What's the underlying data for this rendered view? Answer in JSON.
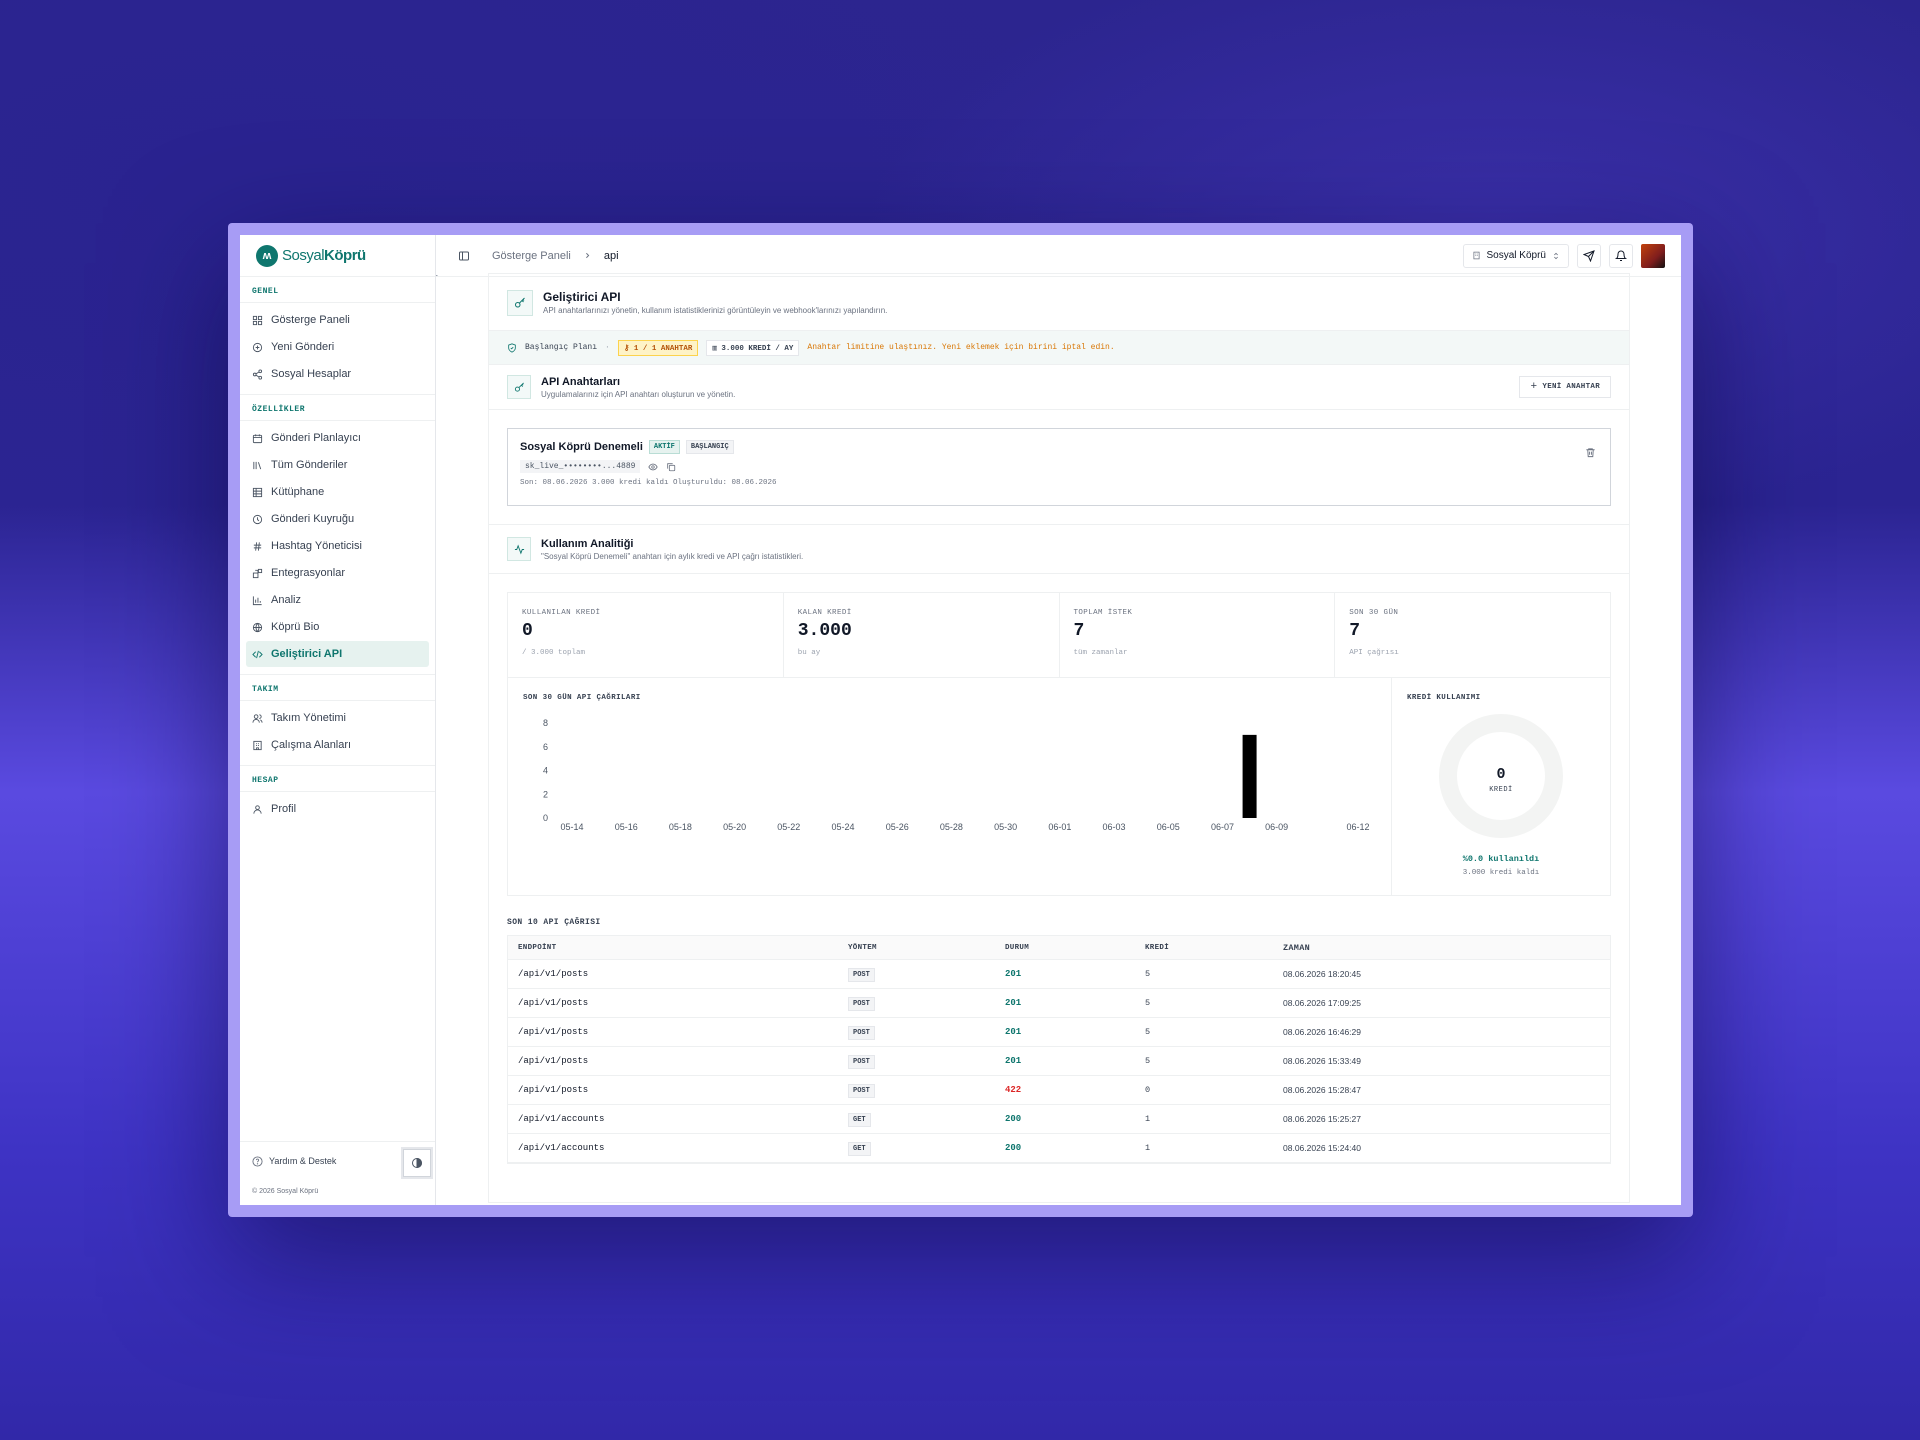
{
  "brand": {
    "part1": "Sosyal",
    "part2": "Köprü"
  },
  "sidebar": {
    "sections": [
      {
        "title": "GENEL",
        "items": [
          {
            "label": "Gösterge Paneli",
            "icon": "dashboard-icon"
          },
          {
            "label": "Yeni Gönderi",
            "icon": "plus-circle-icon"
          },
          {
            "label": "Sosyal Hesaplar",
            "icon": "share-icon"
          }
        ]
      },
      {
        "title": "ÖZELLİKLER",
        "items": [
          {
            "label": "Gönderi Planlayıcı",
            "icon": "calendar-icon"
          },
          {
            "label": "Tüm Gönderiler",
            "icon": "library-icon"
          },
          {
            "label": "Kütüphane",
            "icon": "grid-icon"
          },
          {
            "label": "Gönderi Kuyruğu",
            "icon": "queue-icon"
          },
          {
            "label": "Hashtag Yöneticisi",
            "icon": "hash-icon"
          },
          {
            "label": "Entegrasyonlar",
            "icon": "blocks-icon"
          },
          {
            "label": "Analiz",
            "icon": "bar-chart-icon"
          },
          {
            "label": "Köprü Bio",
            "icon": "globe-icon"
          },
          {
            "label": "Geliştirici API",
            "icon": "code-icon",
            "active": true
          }
        ]
      },
      {
        "title": "TAKIM",
        "items": [
          {
            "label": "Takım Yönetimi",
            "icon": "users-icon"
          },
          {
            "label": "Çalışma Alanları",
            "icon": "building-icon"
          }
        ]
      },
      {
        "title": "HESAP",
        "items": [
          {
            "label": "Profil",
            "icon": "user-icon"
          }
        ]
      }
    ],
    "help": "Yardım & Destek",
    "copyright": "© 2026 Sosyal Köprü"
  },
  "topbar": {
    "crumb1": "Gösterge Paneli",
    "crumb2": "api",
    "workspace": "Sosyal Köprü"
  },
  "page": {
    "title": "Geliştirici API",
    "subtitle": "API anahtarlarınızı yönetin, kullanım istatistiklerinizi görüntüleyin ve webhook'larınızı yapılandırın."
  },
  "plan": {
    "name": "Başlangıç Planı",
    "sep": "·",
    "keys": "1 / 1 ANAHTAR",
    "credits": "3.000 KREDİ / AY",
    "warning": "Anahtar limitine ulaştınız. Yeni eklemek için birini iptal edin."
  },
  "keys_section": {
    "title": "API Anahtarları",
    "subtitle": "Uygulamalarınız için API anahtarı oluşturun ve yönetin.",
    "new_button": "YENİ ANAHTAR"
  },
  "key": {
    "name": "Sosyal Köprü Denemeli",
    "status": "AKTİF",
    "plan": "BAŞLANGIÇ",
    "masked": "sk_live_••••••••...4889",
    "meta": "Son: 08.06.2026  3.000 kredi kaldı  Oluşturuldu: 08.06.2026"
  },
  "analytics": {
    "title": "Kullanım Analitiği",
    "subtitle": "\"Sosyal Köprü Denemeli\" anahtarı için aylık kredi ve API çağrı istatistikleri."
  },
  "stats": [
    {
      "label": "KULLANILAN KREDİ",
      "value": "0",
      "sub": "/ 3.000 toplam"
    },
    {
      "label": "KALAN KREDİ",
      "value": "3.000",
      "sub": "bu ay"
    },
    {
      "label": "TOPLAM İSTEK",
      "value": "7",
      "sub": "tüm zamanlar"
    },
    {
      "label": "SON 30 GÜN",
      "value": "7",
      "sub": "API çağrısı"
    }
  ],
  "chart_data": [
    {
      "type": "bar",
      "title": "SON 30 GÜN API ÇAĞRILARI",
      "x_ticks": [
        "05-14",
        "05-16",
        "05-18",
        "05-20",
        "05-22",
        "05-24",
        "05-26",
        "05-28",
        "05-30",
        "06-01",
        "06-03",
        "06-05",
        "06-07",
        "06-09",
        "06-12"
      ],
      "y_ticks": [
        "0",
        "2",
        "4",
        "6",
        "8"
      ],
      "ylim": [
        0,
        8
      ],
      "bars": [
        {
          "x": "06-08",
          "value": 7
        }
      ],
      "color": "#000000"
    },
    {
      "type": "pie",
      "title": "KREDİ KULLANIMI",
      "center_value": "0",
      "center_label": "KREDİ",
      "used_pct": 0.0,
      "used_text": "%0.0 kullanıldı",
      "remaining_text": "3.000 kredi kaldı"
    }
  ],
  "calls": {
    "title": "SON 10 API ÇAĞRISI",
    "headers": [
      "ENDPOİNT",
      "YÖNTEM",
      "DURUM",
      "KREDİ",
      "ZAMAN"
    ],
    "rows": [
      [
        "/api/v1/posts",
        "POST",
        "201",
        "5",
        "08.06.2026 18:20:45"
      ],
      [
        "/api/v1/posts",
        "POST",
        "201",
        "5",
        "08.06.2026 17:09:25"
      ],
      [
        "/api/v1/posts",
        "POST",
        "201",
        "5",
        "08.06.2026 16:46:29"
      ],
      [
        "/api/v1/posts",
        "POST",
        "201",
        "5",
        "08.06.2026 15:33:49"
      ],
      [
        "/api/v1/posts",
        "POST",
        "422",
        "0",
        "08.06.2026 15:28:47"
      ],
      [
        "/api/v1/accounts",
        "GET",
        "200",
        "1",
        "08.06.2026 15:25:27"
      ],
      [
        "/api/v1/accounts",
        "GET",
        "200",
        "1",
        "08.06.2026 15:24:40"
      ]
    ]
  },
  "colors": {
    "accent": "#0f766e",
    "warning": "#d97706",
    "error": "#dc2626"
  }
}
